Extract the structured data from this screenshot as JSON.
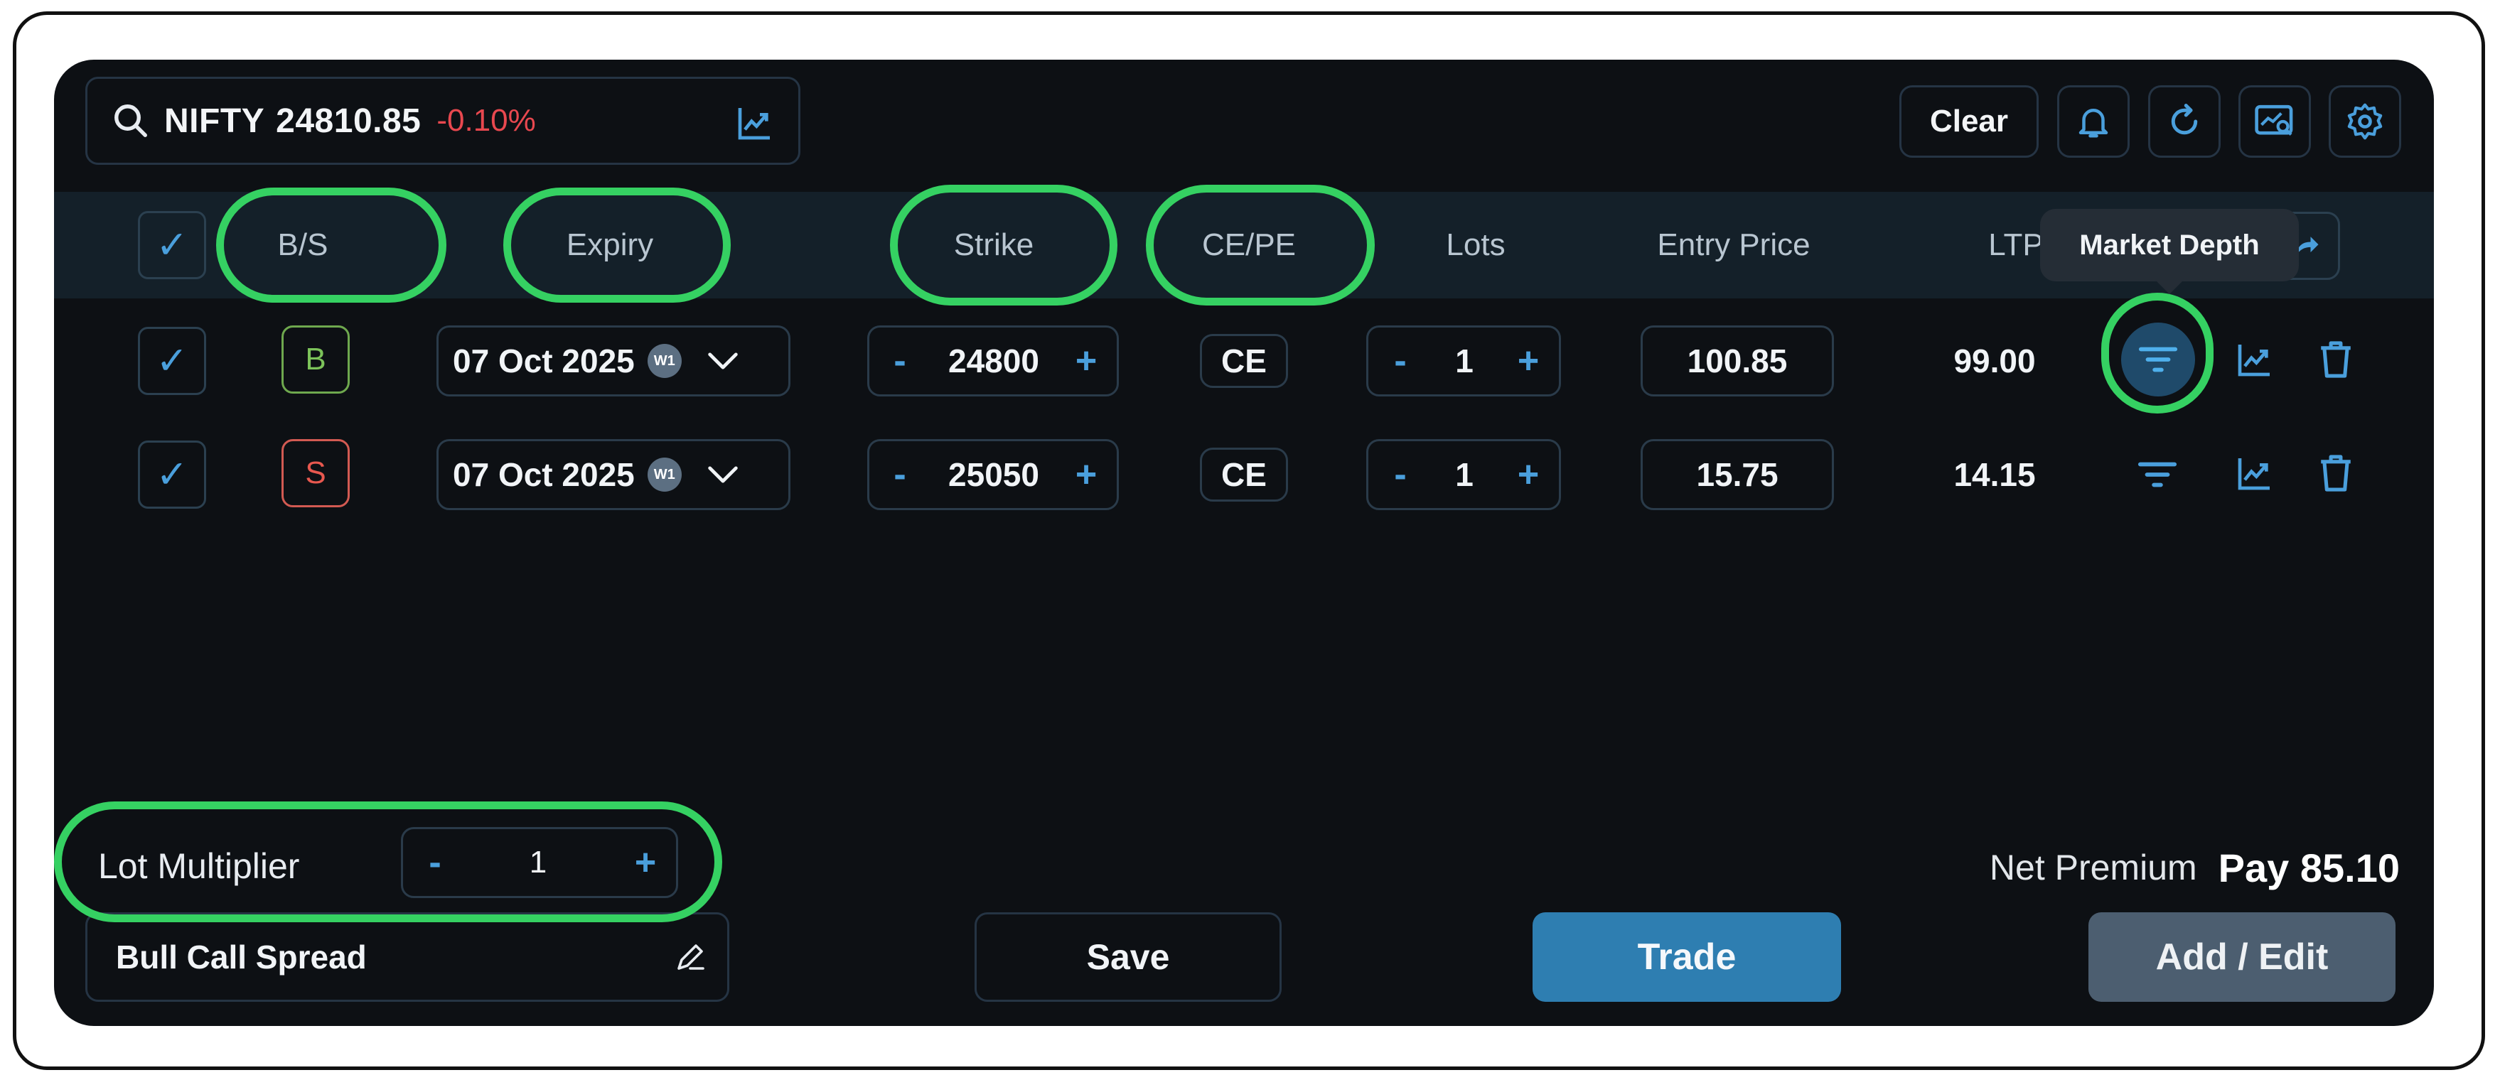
{
  "search": {
    "symbol": "NIFTY",
    "price": "24810.85",
    "change": "-0.10%"
  },
  "toolbar": {
    "clear_label": "Clear"
  },
  "header": {
    "bs": "B/S",
    "expiry": "Expiry",
    "strike": "Strike",
    "cepe": "CE/PE",
    "lots": "Lots",
    "entry_price": "Entry Price",
    "ltp": "LTP"
  },
  "tooltip": {
    "market_depth": "Market Depth"
  },
  "rows": [
    {
      "side": "B",
      "expiry": "07 Oct 2025",
      "week": "W1",
      "strike": "24800",
      "type": "CE",
      "lots": "1",
      "entry_price": "100.85",
      "ltp": "99.00"
    },
    {
      "side": "S",
      "expiry": "07 Oct 2025",
      "week": "W1",
      "strike": "25050",
      "type": "CE",
      "lots": "1",
      "entry_price": "15.75",
      "ltp": "14.15"
    }
  ],
  "stepper": {
    "minus": "-",
    "plus": "+"
  },
  "lot_multiplier": {
    "label": "Lot Multiplier",
    "value": "1"
  },
  "net_premium": {
    "label": "Net Premium",
    "value": "Pay 85.10"
  },
  "footer": {
    "strategy_name": "Bull Call Spread",
    "save_label": "Save",
    "trade_label": "Trade",
    "add_edit_label": "Add / Edit"
  },
  "colors": {
    "buy": "#7cc35a",
    "sell": "#e8584f",
    "accent": "#4a9fdc",
    "highlight": "#35d162",
    "trade_button": "#2e7eb1"
  }
}
